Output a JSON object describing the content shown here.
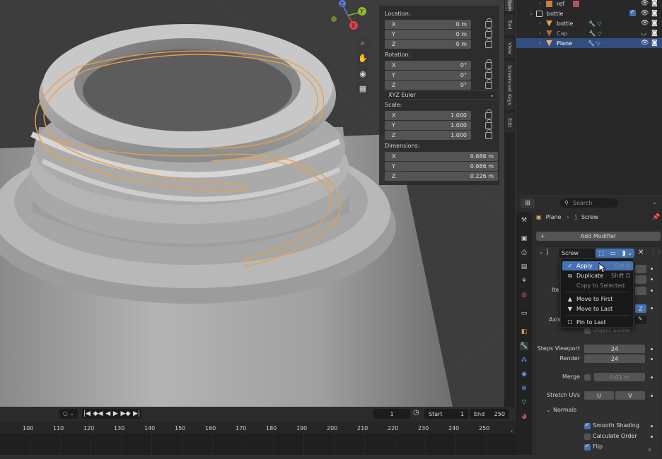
{
  "n_panel": {
    "location_label": "Location:",
    "location": [
      {
        "axis": "X",
        "value": "0 m"
      },
      {
        "axis": "Y",
        "value": "0 m"
      },
      {
        "axis": "Z",
        "value": "0 m"
      }
    ],
    "rotation_label": "Rotation:",
    "rotation": [
      {
        "axis": "X",
        "value": "0°"
      },
      {
        "axis": "Y",
        "value": "0°"
      },
      {
        "axis": "Z",
        "value": "0°"
      }
    ],
    "rotation_mode": "XYZ Euler",
    "scale_label": "Scale:",
    "scale": [
      {
        "axis": "X",
        "value": "1.000"
      },
      {
        "axis": "Y",
        "value": "1.000"
      },
      {
        "axis": "Z",
        "value": "1.000"
      }
    ],
    "dimensions_label": "Dimensions:",
    "dimensions": [
      {
        "axis": "X",
        "value": "0.686 m"
      },
      {
        "axis": "Y",
        "value": "0.686 m"
      },
      {
        "axis": "Z",
        "value": "0.226 m"
      }
    ]
  },
  "gizmo": {
    "x": "X",
    "y": "Y",
    "z": "Z"
  },
  "sidebar_tabs": [
    "Item",
    "Tool",
    "View",
    "Screencast Keys",
    "Edit"
  ],
  "outliner": {
    "rows": [
      {
        "name": "ref"
      },
      {
        "name": "bottle"
      },
      {
        "name": "bottle"
      },
      {
        "name": "Cap"
      },
      {
        "name": "Plane"
      }
    ]
  },
  "properties": {
    "search_placeholder": "Search",
    "breadcrumb_object": "Plane",
    "breadcrumb_modifier": "Screw",
    "add_modifier": "Add Modifier",
    "modifier_name": "Screw",
    "item_label": "Ite",
    "axis_label": "Axis",
    "axis_value": "Z",
    "object_screw": "Object Screw",
    "steps_viewport_label": "Steps Viewport",
    "steps_viewport_value": "24",
    "render_label": "Render",
    "render_value": "24",
    "merge_label": "Merge",
    "merge_value": "0.01 m",
    "stretch_uvs_label": "Stretch UVs",
    "stretch_u": "U",
    "stretch_v": "V",
    "normals_label": "Normals",
    "smooth_shading": "Smooth Shading",
    "calculate_order": "Calculate Order",
    "flip": "Flip"
  },
  "dropdown": {
    "apply": "Apply",
    "apply_shortcut": "Ctrl A",
    "duplicate": "Duplicate",
    "duplicate_shortcut": "Shift D",
    "copy_to_selected": "Copy to Selected",
    "move_to_first": "Move to First",
    "move_to_last": "Move to Last",
    "pin_to_last": "Pin to Last"
  },
  "timeline": {
    "current_frame": "1",
    "start_label": "Start",
    "start_value": "1",
    "end_label": "End",
    "end_value": "250",
    "frames": [
      "100",
      "110",
      "120",
      "130",
      "140",
      "150",
      "160",
      "170",
      "180",
      "190",
      "200",
      "210",
      "220",
      "230",
      "240",
      "250"
    ]
  },
  "colors": {
    "accent": "#4772b3",
    "selection_outline": "#e8a04a",
    "background": "#3d3d3d"
  }
}
